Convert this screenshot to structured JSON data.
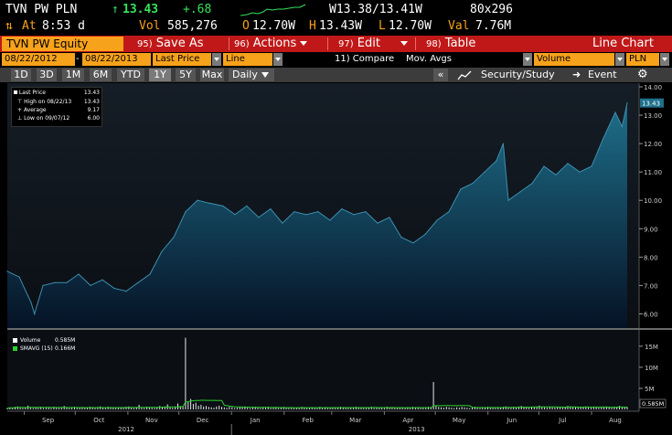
{
  "quote": {
    "ticker": "TVN PW PLN",
    "last_arrow": "↑",
    "last": "13.43",
    "change": "+.68",
    "bid_label": "W",
    "bid": "13.38",
    "ask": "13.41",
    "ask_suffix": "W",
    "size": "80x296",
    "time_label": "At",
    "time": "8:53 d",
    "vol_label": "Vol",
    "vol": "585,276",
    "open_label": "O",
    "open": "12.70W",
    "high_label": "H",
    "high": "13.43W",
    "low_label": "L",
    "low": "12.70W",
    "val_label": "Val",
    "val": "7.76M"
  },
  "menu": {
    "security": "TVN PW Equity",
    "save_num": "95)",
    "save": "Save As",
    "actions_num": "96)",
    "actions": "Actions",
    "edit_num": "97)",
    "edit": "Edit",
    "table_num": "98)",
    "table": "Table",
    "view": "Line Chart"
  },
  "params": {
    "start": "08/22/2012",
    "end": "08/22/2013",
    "field": "Last Price",
    "style": "Line",
    "compare": "11) Compare",
    "mov_avgs": "Mov. Avgs",
    "lower": "Volume",
    "currency": "PLN"
  },
  "ranges": {
    "buttons": [
      "1D",
      "3D",
      "1M",
      "6M",
      "YTD",
      "1Y",
      "5Y",
      "Max"
    ],
    "active": "1Y",
    "period": "Daily",
    "collapse": "«",
    "security_study": "Security/Study",
    "event": "Event",
    "settings_icon": "gear-icon"
  },
  "legend": {
    "last_price_label": "Last Price",
    "last_price": "13.43",
    "high_label": "High on 08/22/13",
    "high": "13.43",
    "average_label": "Average",
    "average": "9.17",
    "low_label": "Low on 09/07/12",
    "low": "6.00"
  },
  "volume_legend": {
    "volume_label": "Volume",
    "volume": "0.585M",
    "smavg_label": "SMAVG (15)",
    "smavg": "0.166M"
  },
  "colors": {
    "accent_amber": "#f7a21b",
    "menu_red": "#c01818",
    "up_green": "#36e25a",
    "area_top": "#1e6f8a",
    "area_bottom": "#061225",
    "volume_bar": "#e8e8e8",
    "smavg_line": "#2bd12b"
  },
  "chart_data": [
    {
      "type": "area",
      "series": [
        {
          "name": "Last Price"
        }
      ],
      "x": [
        "2012-08-22",
        "2012-08-29",
        "2012-09-05",
        "2012-09-07",
        "2012-09-12",
        "2012-09-19",
        "2012-09-26",
        "2012-10-03",
        "2012-10-10",
        "2012-10-17",
        "2012-10-24",
        "2012-10-31",
        "2012-11-07",
        "2012-11-14",
        "2012-11-21",
        "2012-11-28",
        "2012-12-05",
        "2012-12-12",
        "2012-12-19",
        "2012-12-27",
        "2013-01-03",
        "2013-01-10",
        "2013-01-17",
        "2013-01-24",
        "2013-01-31",
        "2013-02-07",
        "2013-02-14",
        "2013-02-21",
        "2013-02-28",
        "2013-03-07",
        "2013-03-14",
        "2013-03-21",
        "2013-03-28",
        "2013-04-04",
        "2013-04-11",
        "2013-04-18",
        "2013-04-25",
        "2013-05-02",
        "2013-05-09",
        "2013-05-16",
        "2013-05-23",
        "2013-05-30",
        "2013-06-06",
        "2013-06-10",
        "2013-06-13",
        "2013-06-20",
        "2013-06-27",
        "2013-07-04",
        "2013-07-11",
        "2013-07-18",
        "2013-07-25",
        "2013-08-01",
        "2013-08-08",
        "2013-08-15",
        "2013-08-19",
        "2013-08-22"
      ],
      "values": [
        7.5,
        7.3,
        6.4,
        6.0,
        7.0,
        7.1,
        7.1,
        7.4,
        7.0,
        7.2,
        6.9,
        6.8,
        7.1,
        7.4,
        8.2,
        8.7,
        9.6,
        10.0,
        9.9,
        9.8,
        9.5,
        9.8,
        9.4,
        9.7,
        9.2,
        9.6,
        9.5,
        9.6,
        9.3,
        9.7,
        9.5,
        9.6,
        9.2,
        9.4,
        8.7,
        8.5,
        8.8,
        9.3,
        9.6,
        10.4,
        10.6,
        11.0,
        11.4,
        12.0,
        10.0,
        10.3,
        10.6,
        11.2,
        10.9,
        11.3,
        11.0,
        11.2,
        12.2,
        13.1,
        12.6,
        13.43
      ],
      "ylim": [
        5.5,
        14.0
      ],
      "yticks": [
        "6.00",
        "7.00",
        "8.00",
        "9.00",
        "10.00",
        "11.00",
        "12.00",
        "13.00",
        "14.00"
      ],
      "last_label": "13.43",
      "xticks": [
        "Sep",
        "Oct",
        "Nov",
        "Dec",
        "Jan",
        "Feb",
        "Mar",
        "Apr",
        "May",
        "Jun",
        "Jul",
        "Aug"
      ],
      "year_labels": [
        "2012",
        "2013"
      ],
      "grid": false
    },
    {
      "type": "bar",
      "series": [
        {
          "name": "Volume",
          "unit": "M"
        },
        {
          "name": "SMAVG (15)",
          "unit": "M"
        }
      ],
      "volume_values": [
        0.3,
        0.5,
        0.4,
        0.6,
        0.7,
        0.4,
        0.3,
        0.5,
        0.9,
        0.4,
        0.3,
        0.5,
        0.4,
        0.6,
        0.3,
        0.4,
        0.5,
        0.3,
        0.6,
        0.4,
        0.3,
        0.4,
        0.8,
        0.5,
        0.3,
        0.4,
        0.6,
        0.3,
        0.4,
        0.5,
        0.3,
        0.4,
        0.6,
        0.5,
        0.3,
        0.4,
        0.7,
        0.4,
        0.3,
        0.6,
        0.4,
        0.5,
        0.3,
        0.4,
        0.5,
        0.4,
        0.6,
        0.7,
        0.4,
        0.3,
        0.5,
        1.1,
        0.4,
        0.3,
        0.6,
        0.5,
        0.4,
        0.3,
        0.5,
        0.8,
        0.6,
        0.7,
        1.2,
        0.5,
        0.4,
        0.6,
        1.4,
        0.8,
        0.7,
        17.0,
        1.8,
        2.5,
        1.3,
        1.6,
        0.9,
        1.1,
        0.7,
        0.8,
        0.6,
        0.5,
        0.4,
        0.7,
        0.9,
        0.6,
        0.5,
        0.4,
        0.6,
        0.5,
        0.3,
        0.4,
        0.6,
        0.5,
        0.7,
        0.4,
        0.3,
        0.5,
        0.6,
        0.4,
        0.3,
        0.5,
        0.4,
        0.6,
        0.3,
        0.4,
        0.5,
        0.3,
        0.4,
        0.6,
        0.4,
        0.3,
        0.5,
        0.4,
        0.3,
        0.4,
        0.6,
        0.5,
        0.3,
        0.4,
        0.5,
        0.4,
        0.3,
        0.6,
        0.4,
        0.5,
        0.3,
        0.4,
        0.5,
        0.3,
        0.4,
        0.6,
        0.5,
        0.4,
        0.3,
        0.5,
        0.4,
        0.6,
        0.5,
        0.4,
        0.3,
        0.5,
        0.4,
        0.6,
        0.3,
        0.4,
        0.5,
        0.4,
        0.3,
        0.6,
        0.4,
        0.5,
        0.3,
        0.4,
        0.5,
        0.4,
        0.3,
        0.5,
        0.4,
        0.6,
        0.5,
        0.4,
        0.3,
        0.5,
        0.4,
        0.6,
        0.5,
        6.5,
        0.8,
        0.6,
        0.5,
        0.4,
        0.6,
        0.5,
        0.4,
        0.3,
        0.5,
        0.4,
        0.6,
        0.5,
        0.4,
        0.3,
        0.5,
        0.6,
        0.4,
        0.3,
        0.5,
        0.4,
        0.6,
        0.5,
        0.4,
        0.3,
        0.5,
        0.4,
        0.6,
        0.7,
        0.5,
        0.4,
        0.6,
        0.5,
        0.7,
        0.8,
        0.6,
        0.5,
        0.4,
        0.6,
        0.5,
        0.7,
        0.9,
        0.6,
        0.5,
        0.4,
        0.6,
        0.5,
        0.4,
        0.6,
        0.5,
        0.4,
        0.6,
        0.8,
        0.7,
        0.5,
        0.6,
        0.4,
        0.5,
        0.6,
        0.7,
        0.5,
        0.4,
        0.6,
        0.5,
        0.4,
        0.5,
        0.6,
        0.7,
        0.5,
        0.4,
        0.6,
        0.5,
        0.8,
        0.6,
        0.5,
        0.585
      ],
      "ylim": [
        0,
        18
      ],
      "yticks": [
        "5M",
        "10M",
        "15M"
      ],
      "last_label": "0.585M"
    }
  ]
}
